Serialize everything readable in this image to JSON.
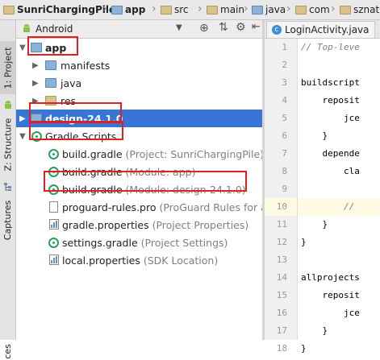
{
  "breadcrumbs": [
    {
      "label": "SunriChargingPile",
      "bold": true
    },
    {
      "label": "app",
      "bold": true
    },
    {
      "label": "src",
      "bold": false
    },
    {
      "label": "main",
      "bold": false
    },
    {
      "label": "java",
      "bold": false
    },
    {
      "label": "com",
      "bold": false
    },
    {
      "label": "sznat",
      "bold": false
    }
  ],
  "toolstrip": {
    "project_tab": "1: Project",
    "structure_tab": "Z: Structure",
    "captures_tab": "Captures",
    "bottom_tab": "ces"
  },
  "panel": {
    "view_selector": "Android",
    "tree": [
      {
        "label": "app",
        "sub": "",
        "bold": true
      },
      {
        "label": "manifests",
        "sub": ""
      },
      {
        "label": "java",
        "sub": ""
      },
      {
        "label": "res",
        "sub": ""
      },
      {
        "label": "design-24.1.0",
        "sub": "",
        "bold": true
      },
      {
        "label": "Gradle Scripts",
        "sub": ""
      },
      {
        "label": "build.gradle",
        "sub": "(Project: SunriChargingPile)"
      },
      {
        "label": "build.gradle",
        "sub": "(Module: app)"
      },
      {
        "label": "build.gradle",
        "sub": "(Module: design-24.1.0)"
      },
      {
        "label": "proguard-rules.pro",
        "sub": "(ProGuard Rules for app)"
      },
      {
        "label": "gradle.properties",
        "sub": "(Project Properties)"
      },
      {
        "label": "settings.gradle",
        "sub": "(Project Settings)"
      },
      {
        "label": "local.properties",
        "sub": "(SDK Location)"
      }
    ]
  },
  "editor": {
    "tab_label": "LoginActivity.java",
    "line_numbers": [
      "1",
      "2",
      "3",
      "4",
      "5",
      "6",
      "7",
      "8",
      "9",
      "10",
      "11",
      "12",
      "13",
      "14",
      "15",
      "16",
      "17",
      "18"
    ],
    "lines": [
      "// Top-leve",
      "",
      "buildscript",
      "    reposit",
      "        jce",
      "    }",
      "    depende",
      "        cla",
      "",
      "        //",
      "    }",
      "}",
      "",
      "allprojects",
      "    reposit",
      "        jce",
      "    }",
      "}"
    ]
  },
  "colors": {
    "selection": "#3875d7",
    "annotation_box": "#e0201e",
    "gradle_icon": "#2e9e5b"
  }
}
